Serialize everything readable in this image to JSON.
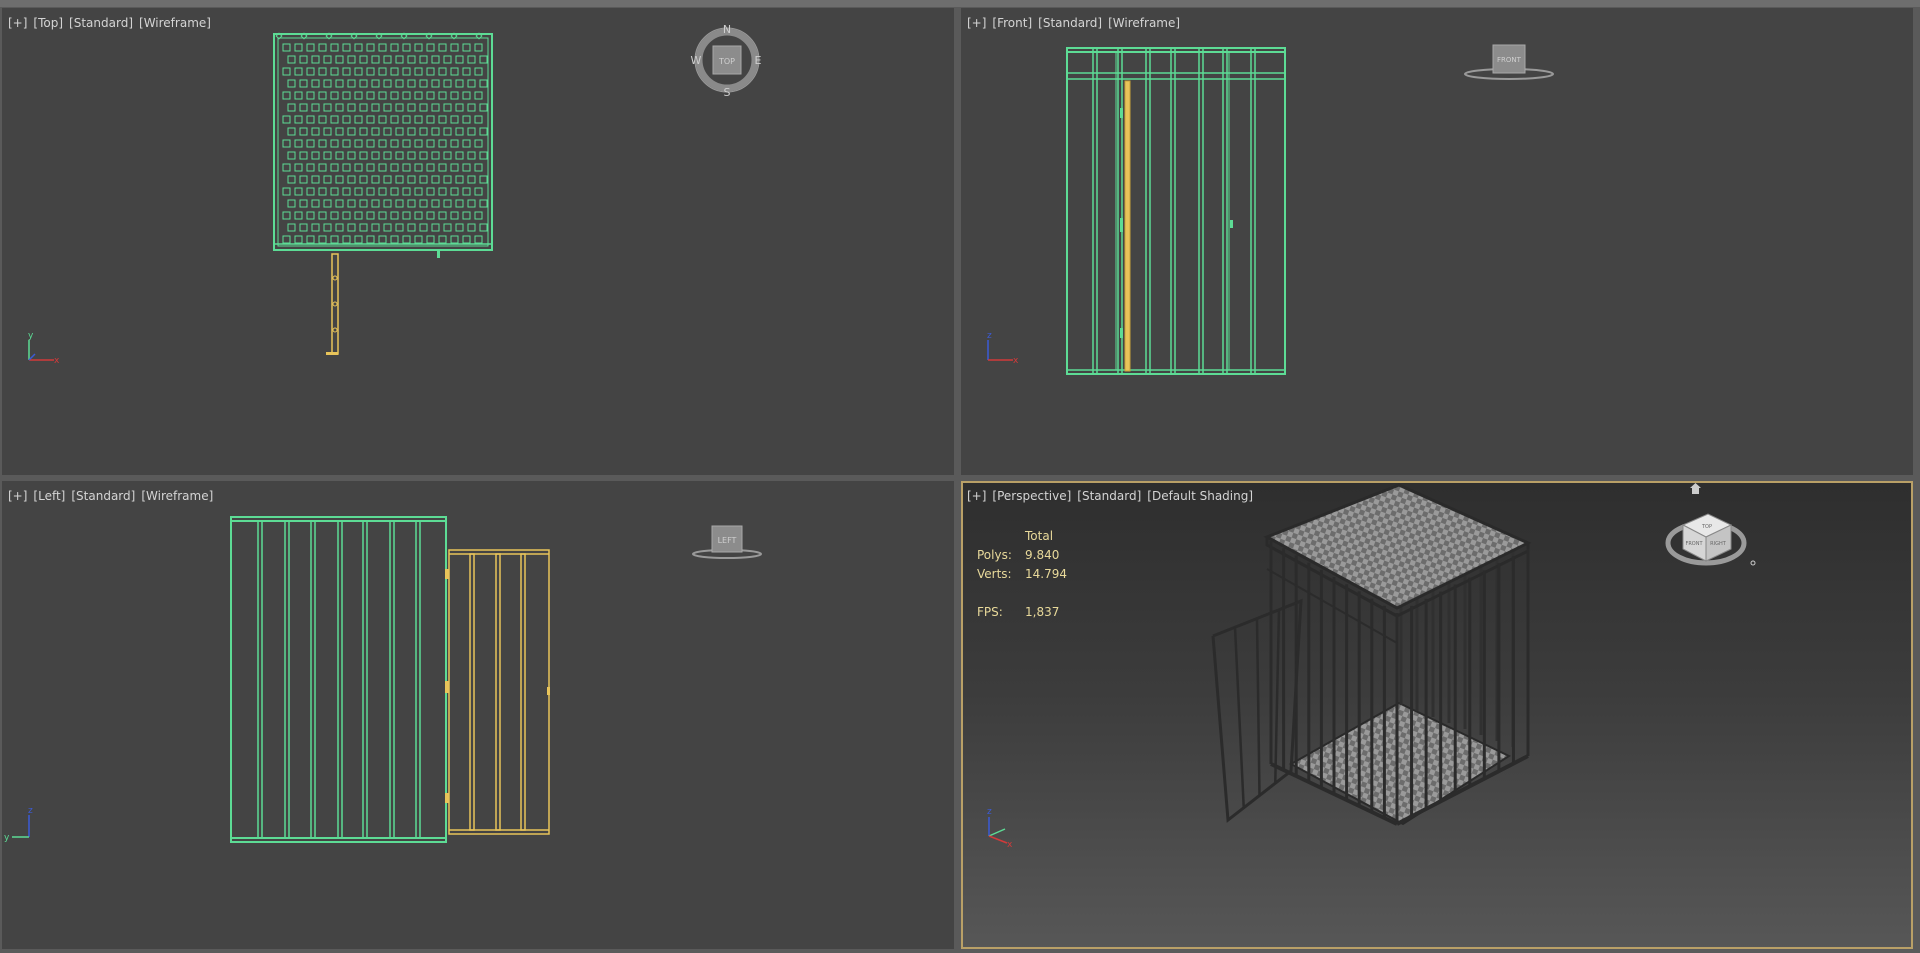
{
  "viewports": {
    "top": {
      "plus": "[+]",
      "view": "[Top]",
      "mode": "[Standard]",
      "shading": "[Wireframe]",
      "viewcube": {
        "face": "TOP",
        "n": "N",
        "s": "S",
        "e": "E",
        "w": "W"
      },
      "axes": {
        "vertical": "y",
        "horizontal": "x"
      }
    },
    "front": {
      "plus": "[+]",
      "view": "[Front]",
      "mode": "[Standard]",
      "shading": "[Wireframe]",
      "viewcube": {
        "face": "FRONT"
      },
      "axes": {
        "vertical": "z",
        "horizontal": "x"
      }
    },
    "left": {
      "plus": "[+]",
      "view": "[Left]",
      "mode": "[Standard]",
      "shading": "[Wireframe]",
      "viewcube": {
        "face": "LEFT"
      },
      "axes": {
        "vertical": "z",
        "horizontal": "y"
      }
    },
    "perspective": {
      "plus": "[+]",
      "view": "[Perspective]",
      "mode": "[Standard]",
      "shading": "[Default Shading]",
      "viewcube": {
        "face_top": "TOP",
        "face_front": "FRONT",
        "face_right": "RIGHT"
      },
      "axes": {
        "vertical": "z",
        "horizontal": "x"
      },
      "stats": {
        "header": "Total",
        "polys_label": "Polys:",
        "polys_value": "9.840",
        "verts_label": "Verts:",
        "verts_value": "14.794",
        "fps_label": "FPS:",
        "fps_value": "1,837"
      }
    }
  },
  "colors": {
    "viewport_bg": "#444444",
    "wire_green": "#5ddc95",
    "wire_selected": "#e8c45a",
    "active_border": "#b9a067",
    "label_text": "#d4d4d4",
    "stats_text": "#e8d99a"
  }
}
